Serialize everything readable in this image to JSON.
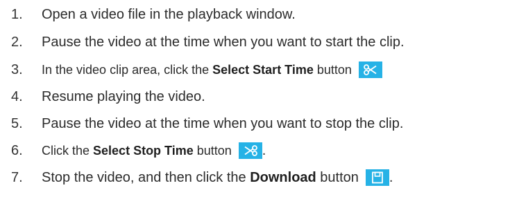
{
  "steps": [
    {
      "num": "1.",
      "text": "Open a video file in the playback window."
    },
    {
      "num": "2.",
      "text": "Pause the video at the time when you want to start the clip."
    },
    {
      "num": "3.",
      "pre": "In the video clip area, click the ",
      "bold": "Select Start Time",
      "post": " button",
      "icon": "scissors-start-icon"
    },
    {
      "num": "4.",
      "text": "Resume playing the video."
    },
    {
      "num": "5.",
      "text": "Pause the video at the time when you want to stop the clip."
    },
    {
      "num": "6.",
      "pre": "Click the ",
      "bold": "Select Stop Time",
      "post": " button",
      "icon": "scissors-stop-icon",
      "tail": "."
    },
    {
      "num": "7.",
      "pre": "Stop the video, and then click the ",
      "bold": "Download",
      "post": " button",
      "icon": "save-icon",
      "tail": "."
    }
  ],
  "colors": {
    "icon_bg": "#26b2e6",
    "icon_fg": "#ffffff",
    "text": "#2b2b2b"
  }
}
